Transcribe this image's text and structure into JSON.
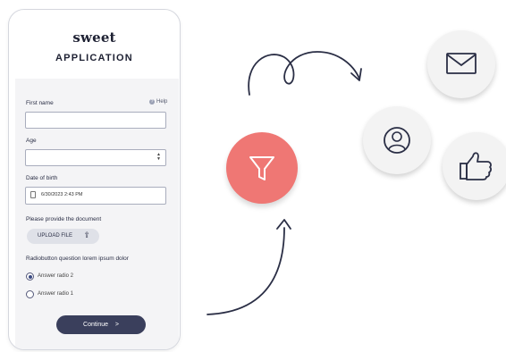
{
  "brand": "sweet",
  "title": "APPLICATION",
  "form": {
    "first_name_label": "First name",
    "help_label": "Help",
    "age_label": "Age",
    "dob_label": "Date of birth",
    "dob_value": "6/30/2023 2:43 PM",
    "document_label": "Please provide the document",
    "upload_label": "UPLOAD FILE",
    "radio_question": "Radiobutton question lorem ipsum dolor",
    "radio_options": [
      {
        "label": "Answer radio 2",
        "selected": true
      },
      {
        "label": "Answer radio 1",
        "selected": false
      }
    ],
    "continue_label": "Continue",
    "continue_chevron": ">"
  },
  "icons": {
    "filter": "filter-icon",
    "mail": "mail-icon",
    "user": "user-icon",
    "like": "thumbs-up-icon"
  },
  "colors": {
    "accent_red": "#ef7774",
    "button_dark": "#3a3f5c"
  }
}
